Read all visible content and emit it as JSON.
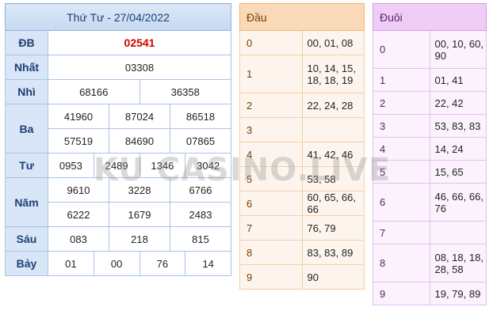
{
  "results": {
    "title": "Thứ Tư - 27/04/2022",
    "rows": [
      {
        "label": "ĐB",
        "values": [
          "02541"
        ]
      },
      {
        "label": "Nhất",
        "values": [
          "03308"
        ]
      },
      {
        "label": "Nhì",
        "values": [
          "68166",
          "36358"
        ]
      },
      {
        "label": "Ba",
        "values": [
          "41960",
          "87024",
          "86518",
          "57519",
          "84690",
          "07865"
        ]
      },
      {
        "label": "Tư",
        "values": [
          "0953",
          "2489",
          "1346",
          "3042"
        ]
      },
      {
        "label": "Năm",
        "values": [
          "9610",
          "3228",
          "6766",
          "6222",
          "1679",
          "2483"
        ]
      },
      {
        "label": "Sáu",
        "values": [
          "083",
          "218",
          "815"
        ]
      },
      {
        "label": "Bảy",
        "values": [
          "01",
          "00",
          "76",
          "14"
        ]
      }
    ]
  },
  "dau": {
    "title": "Đầu",
    "rows": [
      {
        "k": "0",
        "v": "00, 01, 08"
      },
      {
        "k": "1",
        "v": "10, 14, 15, 18, 18, 19"
      },
      {
        "k": "2",
        "v": "22, 24, 28"
      },
      {
        "k": "3",
        "v": ""
      },
      {
        "k": "4",
        "v": "41, 42, 46"
      },
      {
        "k": "5",
        "v": "53, 58"
      },
      {
        "k": "6",
        "v": "60, 65, 66, 66"
      },
      {
        "k": "7",
        "v": "76, 79"
      },
      {
        "k": "8",
        "v": "83, 83, 89"
      },
      {
        "k": "9",
        "v": "90"
      }
    ]
  },
  "duoi": {
    "title": "Đuôi",
    "rows": [
      {
        "k": "0",
        "v": "00, 10, 60, 90"
      },
      {
        "k": "1",
        "v": "01, 41"
      },
      {
        "k": "2",
        "v": "22, 42"
      },
      {
        "k": "3",
        "v": "53, 83, 83"
      },
      {
        "k": "4",
        "v": "14, 24"
      },
      {
        "k": "5",
        "v": "15, 65"
      },
      {
        "k": "6",
        "v": "46, 66, 66, 76"
      },
      {
        "k": "7",
        "v": ""
      },
      {
        "k": "8",
        "v": "08, 18, 18, 28, 58"
      },
      {
        "k": "9",
        "v": "19, 79, 89"
      }
    ]
  },
  "watermark": "KU CASINO.LIVE",
  "colors": {
    "special_prize": "#d40000",
    "results_header": "#c6d9f1",
    "dau_header": "#fad9b8",
    "duoi_header": "#f0cdf7"
  }
}
